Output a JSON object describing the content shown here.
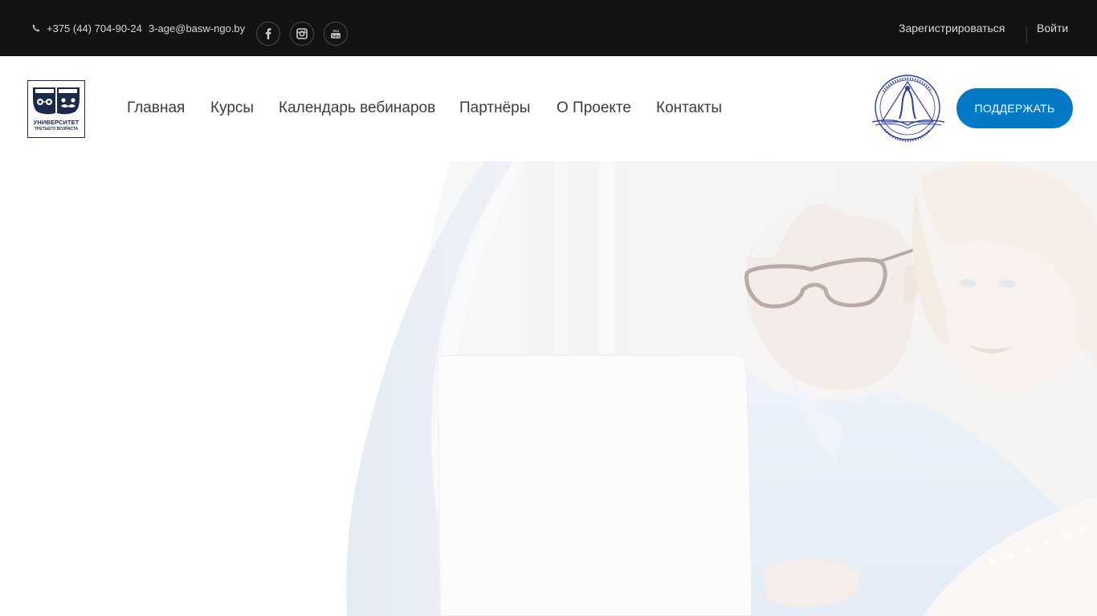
{
  "topbar": {
    "phone": "+375 (44) 704-90-24",
    "email": "3-age@basw-ngo.by",
    "social": [
      "facebook-icon",
      "instagram-icon",
      "youtube-icon"
    ],
    "register": "Зарегистрироваться",
    "login": "Войти"
  },
  "header": {
    "logo": {
      "line1": "УНИВЕРСИТЕТ",
      "line2": "ТРЕТЬЕГО ВОЗРАСТА"
    },
    "nav": [
      "Главная",
      "Курсы",
      "Календарь вебинаров",
      "Партнёры",
      "О Проекте",
      "Контакты"
    ],
    "support_button": "ПОДДЕРЖАТЬ"
  },
  "colors": {
    "topbar_bg": "#131313",
    "accent": "#0578c6",
    "logo_navy": "#1b2a4a",
    "partner_logo_blue": "#2b3d9e"
  }
}
